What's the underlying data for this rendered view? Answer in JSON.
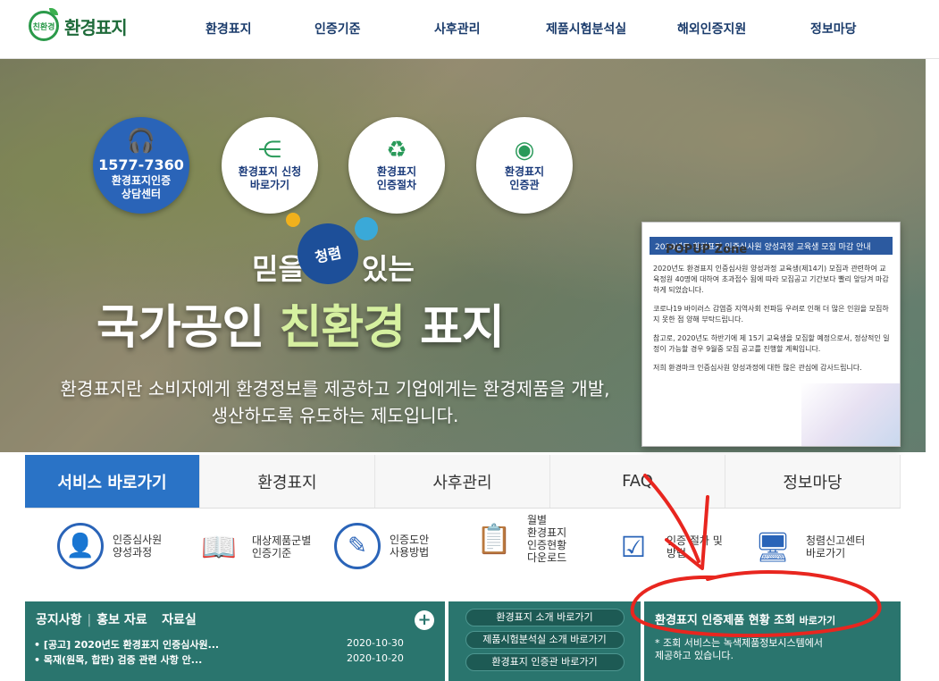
{
  "logo": {
    "mark": "친환경",
    "text": "환경표지"
  },
  "nav": [
    "환경표지",
    "인증기준",
    "사후관리",
    "제품시험분석실",
    "해외인증지원",
    "정보마당"
  ],
  "hero": {
    "center_phone": "1577-7360",
    "center_label": "환경표지인증\n상담센터",
    "circles": [
      {
        "label": "환경표지 신청\n바로가기",
        "icon": "share-network-icon"
      },
      {
        "label": "환경표지\n인증절차",
        "icon": "recycle-leaf-icon"
      },
      {
        "label": "환경표지\n인증관",
        "icon": "eco-label-icon"
      }
    ],
    "subtitle_pre": "믿을",
    "subtitle_post": "있는",
    "stamp": "청렴",
    "title_pre": "국가공인",
    "title_green": "친환경",
    "title_post": "표지",
    "desc": "환경표지란 소비자에게 환경정보를 제공하고 기업에게는 환경제품을 개발, 생산하도록 유도하는 제도입니다."
  },
  "popup": {
    "zone_label": "POPUP Zone",
    "bar": "2020년도 환경표지 인증심사원 양성과정 교육생 모집 마감 안내",
    "paragraphs": [
      "2020년도 환경표지 인증심사원 양성과정 교육생(제14기) 모집과 관련하여 교육정원 40명에 대하여 초과접수 됨에 따라 모집공고 기간보다 빨리 앞당겨 마감하게 되었습니다.",
      "코로나19 바이러스 감염증 지역사회 전파등 우려로 인해 더 많은 인원을 모집하지 못한 점 양해 부탁드립니다.",
      "참고로, 2020년도 하반기에 제 15기 교육생을 모집할 예정으로서, 정상적인 일정이 가능할 경우 9월중 모집 공고를 진행할 계획입니다.",
      "저희 환경마크 인증심사원 양성과정에 대한 많은 관심에 감사드립니다."
    ]
  },
  "tabs": [
    "서비스 바로가기",
    "환경표지",
    "사후관리",
    "FAQ",
    "정보마당"
  ],
  "services": [
    {
      "label": "인증심사원\n양성과정",
      "icon": "person-icon"
    },
    {
      "label": "대상제품군별\n인증기준",
      "icon": "book-icon"
    },
    {
      "label": "인증도안\n사용방법",
      "icon": "pen-icon"
    },
    {
      "label": "월별\n환경표지\n인증현황\n다운로드",
      "icon": "checklist-icon"
    },
    {
      "label": "인증 절차 및\n방법",
      "icon": "document-check-icon"
    },
    {
      "label": "청렴신고센터\n바로가기",
      "icon": "monitor-icon"
    }
  ],
  "notice": {
    "tabs": [
      "공지사항",
      "홍보 자료",
      "자료실"
    ],
    "plus": "+",
    "items": [
      {
        "title": "• [공고] 2020년도 환경표지 인증심사원...",
        "date": "2020-10-30"
      },
      {
        "title": "• 목재(원목, 합판) 검증 관련 사항 안...",
        "date": "2020-10-20"
      }
    ]
  },
  "links": [
    "환경표지 소개 바로가기",
    "제품시험분석실 소개 바로가기",
    "환경표지 인증관 바로가기"
  ],
  "status": {
    "title": "환경표지 인증제품 현황 조회",
    "title_small": "바로가기",
    "desc": "* 조회 서비스는 녹색제품정보시스템에서\n  제공하고 있습니다."
  },
  "colors": {
    "primary": "#2a73c6",
    "teal": "#2a756e",
    "annotation": "#e8261f"
  }
}
